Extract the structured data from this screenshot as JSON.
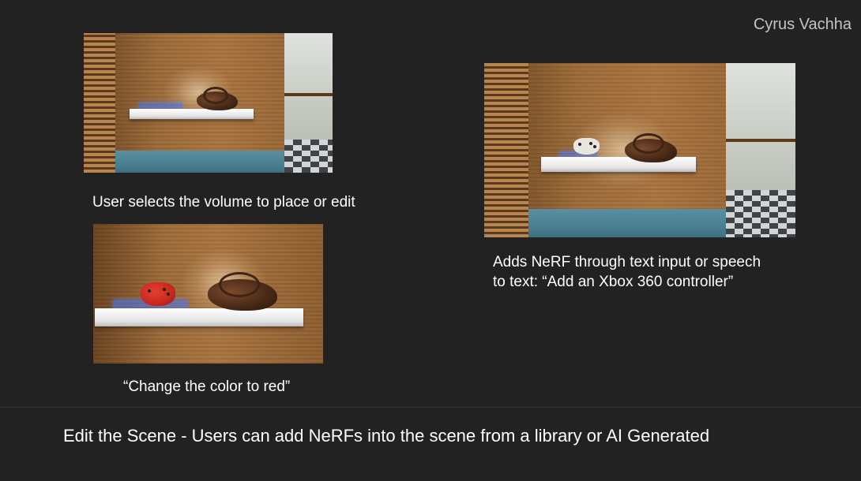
{
  "author": "Cyrus Vachha",
  "panels": [
    {
      "caption": "User selects the volume to place or edit"
    },
    {
      "caption_line1": "Adds NeRF through text input or speech",
      "caption_line2": "to text: “Add an Xbox 360 controller”"
    },
    {
      "caption": "“Change the color to red”"
    }
  ],
  "footer": "Edit the Scene - Users can add NeRFs into the scene from a library or AI Generated",
  "colors": {
    "background": "#222222",
    "selection_volume": "#4678ff",
    "red_controller": "#c8281e",
    "white_controller": "#e8e6df"
  },
  "icons": [
    "vr-headset-model",
    "xbox-controller-model"
  ]
}
